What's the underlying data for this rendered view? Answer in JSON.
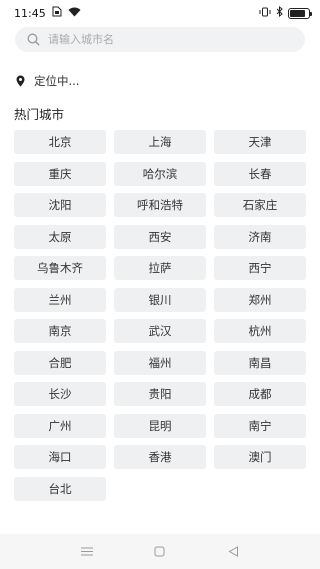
{
  "status_bar": {
    "time": "11:45",
    "battery_level": 0.85
  },
  "search": {
    "placeholder": "请输入城市名",
    "value": ""
  },
  "location": {
    "text": "定位中..."
  },
  "hot_cities": {
    "title": "热门城市",
    "cities": [
      "北京",
      "上海",
      "天津",
      "重庆",
      "哈尔滨",
      "长春",
      "沈阳",
      "呼和浩特",
      "石家庄",
      "太原",
      "西安",
      "济南",
      "乌鲁木齐",
      "拉萨",
      "西宁",
      "兰州",
      "银川",
      "郑州",
      "南京",
      "武汉",
      "杭州",
      "合肥",
      "福州",
      "南昌",
      "长沙",
      "贵阳",
      "成都",
      "广州",
      "昆明",
      "南宁",
      "海口",
      "香港",
      "澳门",
      "台北"
    ]
  },
  "nav": {
    "icons": [
      "menu-icon",
      "home-square-icon",
      "back-triangle-icon"
    ]
  }
}
